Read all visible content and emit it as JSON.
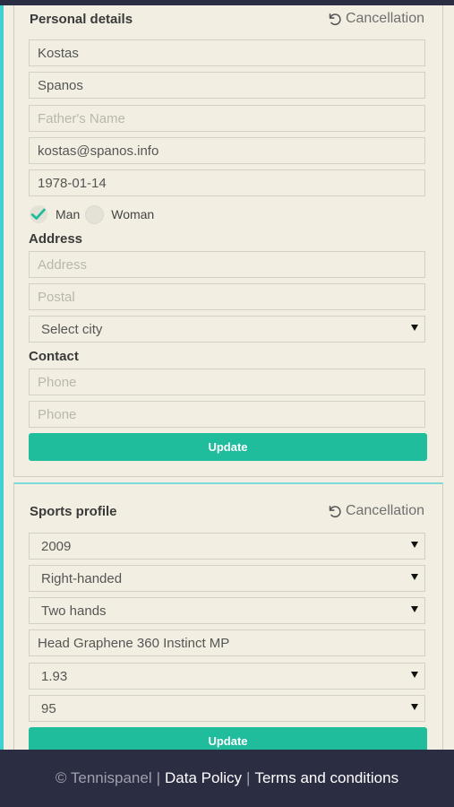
{
  "personal": {
    "title": "Personal details",
    "cancel_label": "Cancellation",
    "first_name": {
      "value": "Kostas",
      "placeholder": ""
    },
    "last_name": {
      "value": "Spanos",
      "placeholder": ""
    },
    "father_name": {
      "value": "",
      "placeholder": "Father's Name"
    },
    "email": {
      "value": "kostas@spanos.info",
      "placeholder": ""
    },
    "birthdate": {
      "value": "1978-01-14",
      "placeholder": ""
    },
    "gender": {
      "man_label": "Man",
      "woman_label": "Woman",
      "selected": "Man"
    },
    "address_heading": "Address",
    "address": {
      "value": "",
      "placeholder": "Address"
    },
    "postal": {
      "value": "",
      "placeholder": "Postal"
    },
    "city": {
      "value": "Select city"
    },
    "contact_heading": "Contact",
    "phone1": {
      "value": "",
      "placeholder": "Phone"
    },
    "phone2": {
      "value": "",
      "placeholder": "Phone"
    },
    "update_label": "Update"
  },
  "sports": {
    "title": "Sports profile",
    "cancel_label": "Cancellation",
    "year": "2009",
    "hand": "Right-handed",
    "backhand": "Two hands",
    "racket": {
      "value": "Head Graphene 360 Instinct MP",
      "placeholder": ""
    },
    "height": "1.93",
    "weight": "95",
    "update_label": "Update"
  },
  "footer": {
    "copyright": "© Tennispanel",
    "separator": "|",
    "data_policy": "Data Policy",
    "terms": "Terms and conditions"
  },
  "colors": {
    "accent": "#1fbd9c",
    "background": "#f2efe2",
    "footer": "#2b2d42",
    "left_accent": "#3fd0cf"
  }
}
